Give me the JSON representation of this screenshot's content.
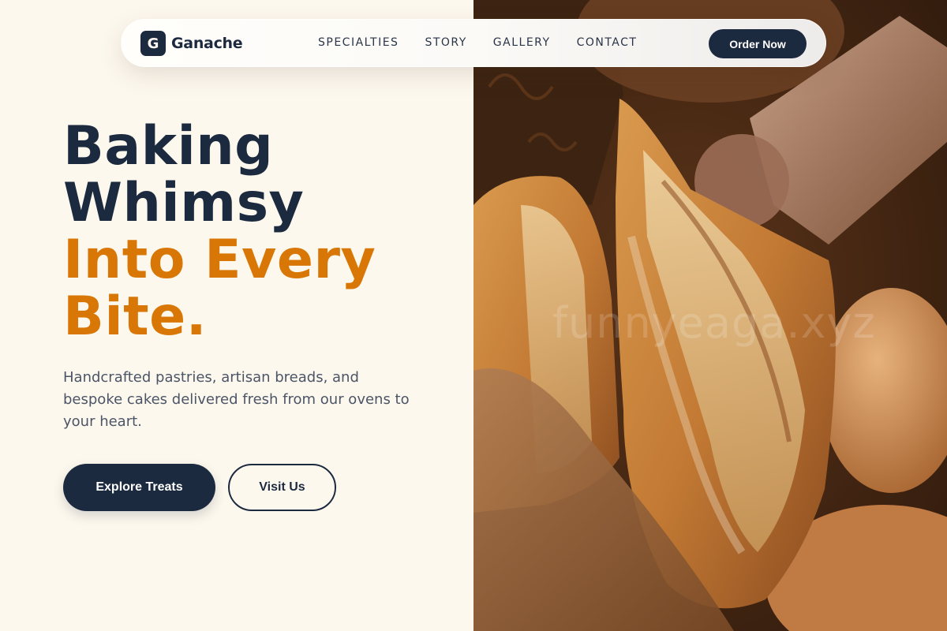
{
  "brand": {
    "logo_letter": "G",
    "name": "Ganache"
  },
  "nav": {
    "links": [
      {
        "label": "SPECIALTIES"
      },
      {
        "label": "STORY"
      },
      {
        "label": "GALLERY"
      },
      {
        "label": "CONTACT"
      }
    ],
    "cta_label": "Order Now"
  },
  "hero": {
    "headline_line1": "Baking",
    "headline_line2": "Whimsy",
    "headline_line3": "Into Every",
    "headline_line4": "Bite.",
    "description": "Handcrafted pastries, artisan breads, and bespoke cakes delivered fresh from our ovens to your heart.",
    "primary_button": "Explore Treats",
    "secondary_button": "Visit Us"
  },
  "photo": {
    "subject": "bread-basket-image",
    "watermark": "funnyeaga.xyz"
  },
  "colors": {
    "navy": "#1c2a3f",
    "accent_orange": "#d97706",
    "cream_background": "#fdf8ee"
  }
}
